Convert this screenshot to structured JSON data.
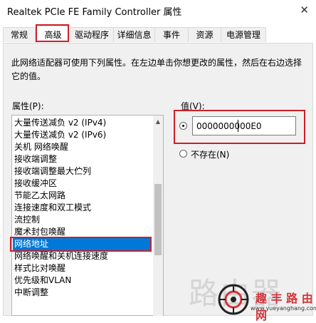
{
  "window": {
    "title": "Realtek PCIe FE Family Controller 属性"
  },
  "tabs": [
    {
      "label": "常规"
    },
    {
      "label": "高级"
    },
    {
      "label": "驱动程序"
    },
    {
      "label": "详细信息"
    },
    {
      "label": "事件"
    },
    {
      "label": "资源"
    },
    {
      "label": "电源管理"
    }
  ],
  "description": "此网络适配器可使用下列属性。在左边单击你想更改的属性，然后在右边选择它的值。",
  "properties": {
    "label": "属性(P):",
    "items": [
      "大量传送减负 v2 (IPv4)",
      "大量传送减负 v2 (IPv6)",
      "关机 网络唤醒",
      "接收端调整",
      "接收端调整最大伫列",
      "接收缓冲区",
      "节能乙太网路",
      "连接速度和双工模式",
      "流控制",
      "魔术封包唤醒",
      "网络地址",
      "网络唤醒和关机连接速度",
      "样式比对唤醒",
      "优先级和VLAN",
      "中断调整"
    ],
    "selected_index": 10
  },
  "value": {
    "label": "值(V):",
    "input_value": "0000000000E0",
    "option_value_checked": true,
    "not_present_label": "不存在(N)",
    "not_present_checked": false
  },
  "watermark": {
    "text": "路由器",
    "brand": "趣 丰 路 由 网",
    "url": "www.yueyanghang.com"
  },
  "colors": {
    "selection": "#0078d7",
    "highlight_box": "#cc1f2a",
    "brand": "#d4343b"
  }
}
